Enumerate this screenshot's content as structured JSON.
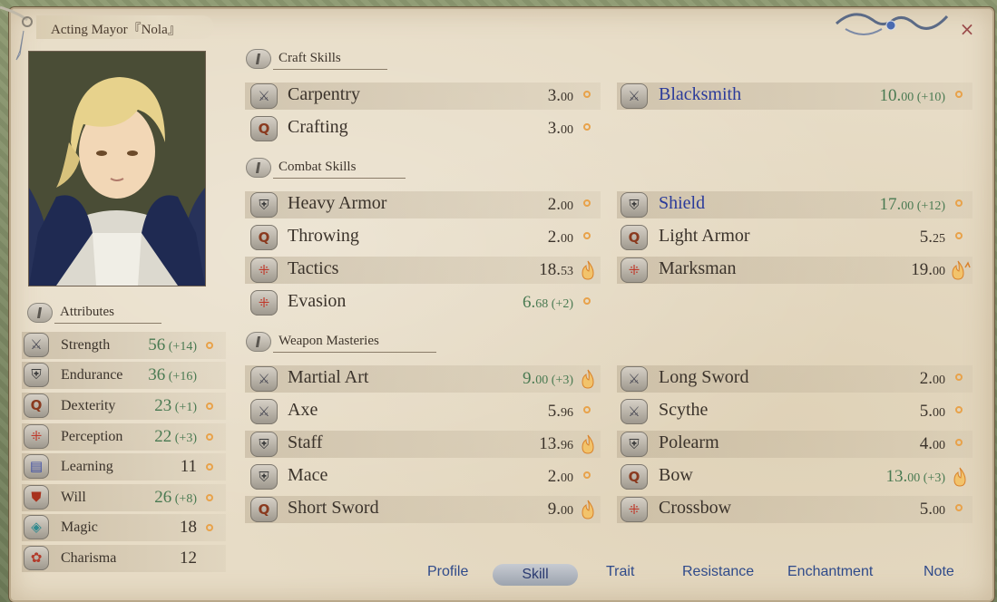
{
  "window": {
    "title": "Acting Mayor『Nola』",
    "close_glyph": "×"
  },
  "sections": {
    "craft": "Craft Skills",
    "combat": "Combat Skills",
    "weapon": "Weapon Masteries",
    "attributes": "Attributes"
  },
  "skills": {
    "carpentry": {
      "name": "Carpentry",
      "base": "3.",
      "dec": "00",
      "bonus": "",
      "icon": "crossed-swords-icon",
      "potential": "circle"
    },
    "blacksmith": {
      "name": "Blacksmith",
      "base": "10.",
      "dec": "00",
      "bonus": " (+10)",
      "icon": "crossed-swords-icon",
      "potential": "circle"
    },
    "crafting": {
      "name": "Crafting",
      "base": "3.",
      "dec": "00",
      "bonus": "",
      "icon": "q-rune-icon",
      "potential": "circle"
    },
    "heavy_armor": {
      "name": "Heavy Armor",
      "base": "2.",
      "dec": "00",
      "bonus": "",
      "icon": "armor-icon",
      "potential": "circle"
    },
    "shield": {
      "name": "Shield",
      "base": "17.",
      "dec": "00",
      "bonus": " (+12)",
      "icon": "armor-icon",
      "potential": "circle"
    },
    "throwing": {
      "name": "Throwing",
      "base": "2.",
      "dec": "00",
      "bonus": "",
      "icon": "q-rune-icon",
      "potential": "circle"
    },
    "light_armor": {
      "name": "Light Armor",
      "base": "5.",
      "dec": "25",
      "bonus": "",
      "icon": "q-rune-icon",
      "potential": "circle"
    },
    "tactics": {
      "name": "Tactics",
      "base": "18.",
      "dec": "53",
      "bonus": "",
      "icon": "grid-rune-icon",
      "potential": "flame"
    },
    "marksman": {
      "name": "Marksman",
      "base": "19.",
      "dec": "00",
      "bonus": "",
      "icon": "grid-rune-icon",
      "potential": "flame-up"
    },
    "evasion": {
      "name": "Evasion",
      "base": "6.",
      "dec": "68",
      "bonus": " (+2)",
      "icon": "grid-rune-icon",
      "potential": "circle"
    },
    "martial_art": {
      "name": "Martial Art",
      "base": "9.",
      "dec": "00",
      "bonus": " (+3)",
      "icon": "crossed-swords-icon",
      "potential": "flame"
    },
    "long_sword": {
      "name": "Long Sword",
      "base": "2.",
      "dec": "00",
      "bonus": "",
      "icon": "crossed-swords-icon",
      "potential": "circle"
    },
    "axe": {
      "name": "Axe",
      "base": "5.",
      "dec": "96",
      "bonus": "",
      "icon": "crossed-swords-icon",
      "potential": "circle"
    },
    "scythe": {
      "name": "Scythe",
      "base": "5.",
      "dec": "00",
      "bonus": "",
      "icon": "crossed-swords-icon",
      "potential": "circle"
    },
    "staff": {
      "name": "Staff",
      "base": "13.",
      "dec": "96",
      "bonus": "",
      "icon": "armor-icon",
      "potential": "flame"
    },
    "polearm": {
      "name": "Polearm",
      "base": "4.",
      "dec": "00",
      "bonus": "",
      "icon": "armor-icon",
      "potential": "circle"
    },
    "mace": {
      "name": "Mace",
      "base": "2.",
      "dec": "00",
      "bonus": "",
      "icon": "armor-icon",
      "potential": "circle"
    },
    "bow": {
      "name": "Bow",
      "base": "13.",
      "dec": "00",
      "bonus": " (+3)",
      "icon": "q-rune-icon",
      "potential": "flame"
    },
    "short_sword": {
      "name": "Short Sword",
      "base": "9.",
      "dec": "00",
      "bonus": "",
      "icon": "q-rune-icon",
      "potential": "flame"
    },
    "crossbow": {
      "name": "Crossbow",
      "base": "5.",
      "dec": "00",
      "bonus": "",
      "icon": "grid-rune-icon",
      "potential": "circle"
    }
  },
  "attributes": {
    "strength": {
      "name": "Strength",
      "value": "56",
      "bonus": " (+14)",
      "icon": "crossed-swords-icon"
    },
    "endurance": {
      "name": "Endurance",
      "value": "36",
      "bonus": " (+16)",
      "icon": "armor-icon"
    },
    "dexterity": {
      "name": "Dexterity",
      "value": "23",
      "bonus": " (+1)",
      "icon": "q-rune-icon"
    },
    "perception": {
      "name": "Perception",
      "value": "22",
      "bonus": " (+3)",
      "icon": "grid-rune-icon"
    },
    "learning": {
      "name": "Learning",
      "value": "11",
      "bonus": "",
      "icon": "book-icon"
    },
    "will": {
      "name": "Will",
      "value": "26",
      "bonus": " (+8)",
      "icon": "shield-icon"
    },
    "magic": {
      "name": "Magic",
      "value": "18",
      "bonus": "",
      "icon": "magic-rune-icon"
    },
    "charisma": {
      "name": "Charisma",
      "value": "12",
      "bonus": "",
      "icon": "ribbon-icon"
    }
  },
  "tabs": {
    "profile": "Profile",
    "skill": "Skill",
    "trait": "Trait",
    "resistance": "Resistance",
    "enchantment": "Enchantment",
    "note": "Note",
    "active": "Skill"
  },
  "colors": {
    "parchment": "#e7dcc6",
    "bonus_green": "#4a7a52",
    "highlight_blue": "#2a3a9a",
    "potential_orange": "#e8a24a"
  }
}
